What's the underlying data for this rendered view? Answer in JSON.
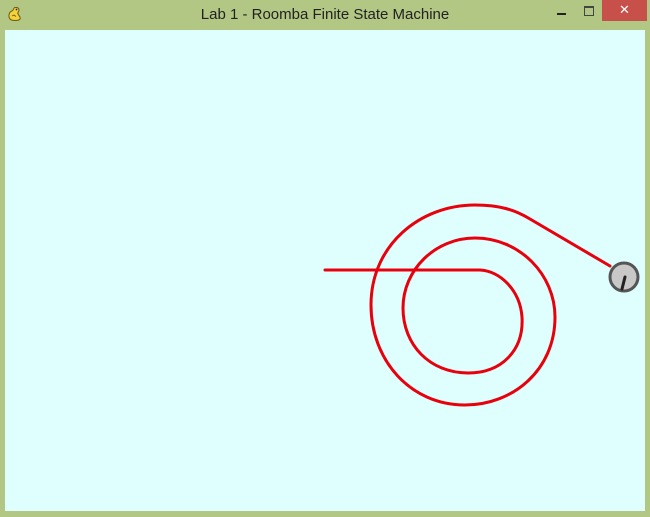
{
  "window": {
    "title": "Lab 1 - Roomba Finite State Machine",
    "app_icon": "pygame-snake-icon",
    "controls": {
      "minimize_icon": "minimize-icon",
      "maximize_icon": "maximize-icon",
      "close_icon": "close-icon",
      "close_glyph": "✕"
    }
  },
  "colors": {
    "frame": "#b3c785",
    "canvas_background": "#dfffff",
    "path": "#e8000c",
    "robot_body": "#c8c8c8",
    "robot_outline": "#555555",
    "robot_heading": "#222222",
    "close_button": "#c7504a"
  },
  "scene": {
    "path_label": "trajectory-path",
    "robot_label": "roomba-robot"
  }
}
